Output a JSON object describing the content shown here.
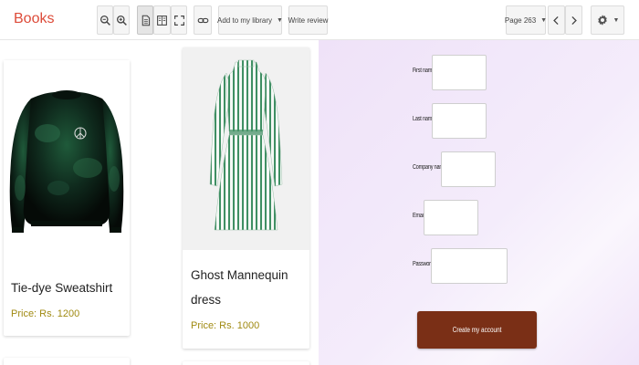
{
  "toolbar": {
    "brand": "Books",
    "add_to_library": "Add to my library",
    "write_review": "Write review",
    "page_label": "Page 263"
  },
  "products": [
    {
      "name": "Tie-dye Sweatshirt",
      "price": "Price: Rs. 1200"
    },
    {
      "name_line1": "Ghost Mannequin",
      "name_line2": "dress",
      "price": "Price: Rs. 1000"
    }
  ],
  "signup": {
    "first_name_label": "First name",
    "last_name_label": "Last name",
    "company_name_label": "Company name",
    "email_label": "Email",
    "password_label": "Password",
    "submit_label": "Create my account"
  },
  "colors": {
    "brand": "#dd4b39",
    "price": "#a08a12",
    "submit_button": "#7a2f16",
    "panel_bg": "#efe2f8"
  }
}
